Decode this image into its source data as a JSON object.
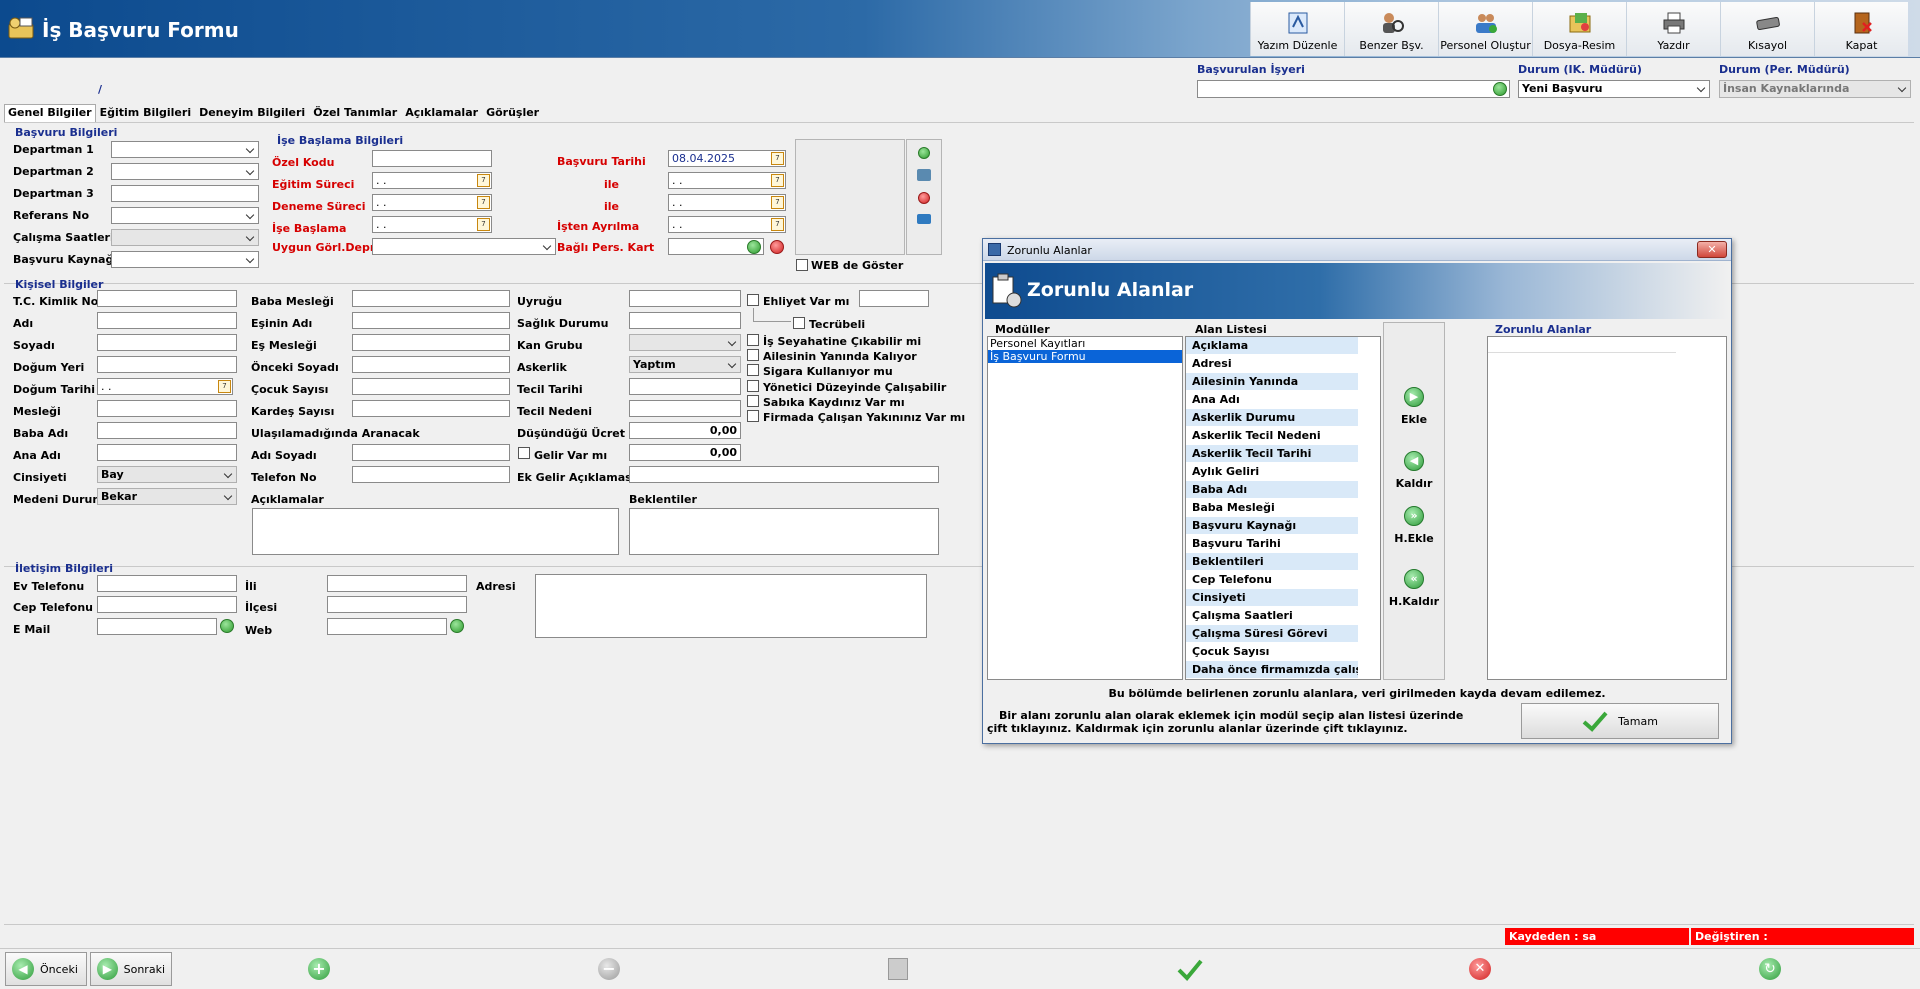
{
  "app": {
    "title": "İş Başvuru Formu",
    "slash": "/"
  },
  "toolbar": [
    {
      "label": "Yazım Düzenle",
      "icon": "text-edit-icon"
    },
    {
      "label": "Benzer Bşv.",
      "icon": "similar-applications-icon"
    },
    {
      "label": "Personel Oluştur",
      "icon": "create-staff-icon"
    },
    {
      "label": "Dosya-Resim",
      "icon": "file-image-icon"
    },
    {
      "label": "Yazdır",
      "icon": "printer-icon"
    },
    {
      "label": "Kısayol",
      "icon": "keyboard-shortcut-icon"
    },
    {
      "label": "Kapat",
      "icon": "exit-door-icon"
    }
  ],
  "top_fields": {
    "employer_label": "Başvurulan İşyeri",
    "employer_value": "",
    "ik_status_label": "Durum (IK. Müdürü)",
    "ik_status_value": "Yeni Başvuru",
    "per_status_label": "Durum (Per. Müdürü)",
    "per_status_value": "İnsan Kaynaklarında"
  },
  "tabs": [
    "Genel Bilgiler",
    "Eğitim Bilgileri",
    "Deneyim Bilgileri",
    "Özel Tanımlar",
    "Açıklamalar",
    "Görüşler"
  ],
  "basvuru": {
    "title": "Başvuru Bilgileri",
    "fields": [
      "Departman 1",
      "Departman 2",
      "Departman 3",
      "Referans No",
      "Çalışma Saatleri",
      "Başvuru Kaynağı"
    ]
  },
  "ise_baslama": {
    "title": "İşe Başlama Bilgileri",
    "ozel_kodu": "Özel Kodu",
    "basvuru_tarihi": "Başvuru Tarihi",
    "basvuru_tarihi_value": "08.04.2025",
    "egitim_sureci": "Eğitim Süreci",
    "deneme_sureci": "Deneme Süreci",
    "ile": "ile",
    "ise_baslama": "İşe Başlama",
    "isten_ayrilma": "İşten Ayrılma",
    "uygun_gorl": "Uygun Görl.Depr.",
    "bagli_pers": "Bağlı Pers. Kart",
    "empty_date": " .  .",
    "web_goster": "WEB de Göster"
  },
  "kisisel": {
    "title": "Kişisel Bilgiler",
    "col1": [
      "T.C. Kimlik No",
      "Adı",
      "Soyadı",
      "Doğum Yeri",
      "Doğum Tarihi",
      "Mesleği",
      "Baba Adı",
      "Ana Adı",
      "Cinsiyeti",
      "Medeni Durum"
    ],
    "cinsiyet_value": "Bay",
    "medeni_value": "Bekar",
    "col2": [
      "Baba Mesleği",
      "Eşinin Adı",
      "Eş Mesleği",
      "Önceki Soyadı",
      "Çocuk Sayısı",
      "Kardeş Sayısı"
    ],
    "ulasilamadiginda": "Ulaşılamadığında Aranacak",
    "adi_soyadi": "Adı Soyadı",
    "telefon_no": "Telefon No",
    "aciklamalar": "Açıklamalar",
    "col3": [
      "Uyruğu",
      "Sağlık Durumu",
      "Kan Grubu",
      "Askerlik",
      "Tecil Tarihi",
      "Tecil Nedeni",
      "Düşündüğü Ücret"
    ],
    "askerlik_value": "Yaptım",
    "ucret_value": "0,00",
    "gelir_var": "Gelir Var mı",
    "gelir_value": "0,00",
    "ek_gelir": "Ek Gelir Açıklaması",
    "beklentiler": "Beklentiler",
    "checks": [
      "Ehliyet Var mı",
      "Tecrübeli",
      "İş Seyahatine Çıkabilir mi",
      "Ailesinin Yanında Kalıyor",
      "Sigara Kullanıyor mu",
      "Yönetici Düzeyinde Çalışabilir",
      "Sabıka Kaydınız Var mı",
      "Firmada Çalışan Yakınınız Var mı"
    ]
  },
  "iletisim": {
    "title": "İletişim Bilgileri",
    "ev_tel": "Ev Telefonu",
    "cep_tel": "Cep Telefonu",
    "email": "E Mail",
    "ili": "İli",
    "ilcesi": "İlçesi",
    "web": "Web",
    "adresi": "Adresi"
  },
  "dialog": {
    "window_title": "Zorunlu Alanlar",
    "banner_title": "Zorunlu Alanlar",
    "moduller_label": "Modüller",
    "alan_listesi_label": "Alan Listesi",
    "zorunlu_label": "Zorunlu Alanlar",
    "modules": [
      "Personel Kayıtları",
      "İş Başvuru Formu"
    ],
    "fields": [
      "Açıklama",
      "Adresi",
      "Ailesinin Yanında",
      "Ana Adı",
      "Askerlik Durumu",
      "Askerlik Tecil Nedeni",
      "Askerlik Tecil Tarihi",
      "Aylık Geliri",
      "Baba Adı",
      "Baba Mesleği",
      "Başvuru Kaynağı",
      "Başvuru Tarihi",
      "Beklentileri",
      "Cep Telefonu",
      "Cinsiyeti",
      "Çalışma Saatleri",
      "Çalışma Süresi Görevi",
      "Çocuk Sayısı",
      "Daha önce firmamızda çalıştı"
    ],
    "buttons": {
      "ekle": "Ekle",
      "kaldir": "Kaldır",
      "hekle": "H.Ekle",
      "hkaldir": "H.Kaldır"
    },
    "notice": "Bu bölümde belirlenen zorunlu alanlara, veri girilmeden kayda devam edilemez.",
    "help_line1": "Bir alanı zorunlu alan olarak eklemek için modül seçip alan listesi üzerinde",
    "help_line2": "çift tıklayınız. Kaldırmak için zorunlu alanlar üzerinde çift tıklayınız.",
    "ok": "Tamam"
  },
  "status": {
    "kaydeden": "Kaydeden : sa",
    "degistiren": "Değiştiren :"
  },
  "footer": {
    "prev": "Önceki",
    "next": "Sonraki"
  }
}
